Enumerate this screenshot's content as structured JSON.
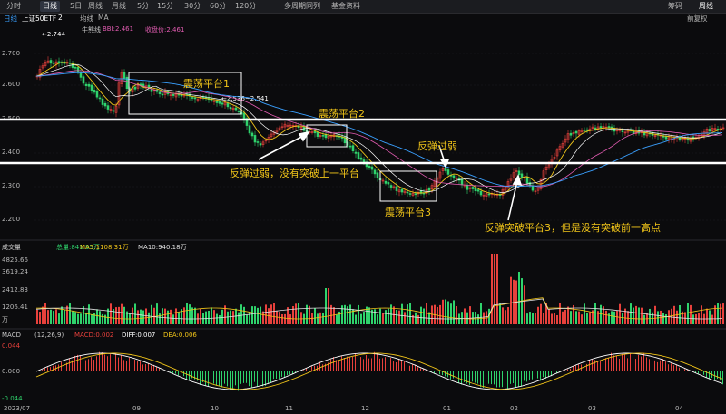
{
  "toolbar": {
    "tabs": [
      "分时",
      "日线",
      "5日",
      "周线",
      "月线",
      "5分",
      "15分",
      "30分",
      "60分",
      "120分",
      "多周期同列",
      "基金资料"
    ],
    "active_tab": "日线",
    "right_items": [
      "筹码",
      "周线"
    ]
  },
  "subbar": {
    "period": "日线",
    "symbol": "上证50ETF",
    "count": "2",
    "ma_label": "均线",
    "ma_prefix": "MA",
    "right": "前复权"
  },
  "price_panel": {
    "indicator_name": "牛熊线",
    "bbi": "BBI:2.461",
    "close": "收盘价:2.461",
    "high_marker": "←2.744",
    "mid_marker": "←2.536~2.541",
    "y_ticks": [
      "2.700",
      "2.600",
      "2.500",
      "2.400",
      "2.300",
      "2.200"
    ]
  },
  "annotations": {
    "platform1": "震荡平台1",
    "platform2": "震荡平台2",
    "platform3": "震荡平台3",
    "rebound_weak_1": "反弹过弱，没有突破上一平台",
    "rebound_weak_2": "反弹过弱",
    "rebound_break_3": "反弹突破平台3，但是没有突破前一高点"
  },
  "volume_panel": {
    "title": "成交量",
    "total": "总量:841.95万",
    "ma5": "MA5:1108.31万",
    "ma10": "MA10:940.18万",
    "y_ticks": [
      "4825.66",
      "3619.24",
      "2412.83",
      "1206.41"
    ],
    "unit": "万"
  },
  "macd_panel": {
    "title": "MACD",
    "params": "(12,26,9)",
    "macd": "MACD:0.002",
    "diff": "DIFF:0.007",
    "dea": "DEA:0.006",
    "y_ticks": [
      "0.044",
      "0.000",
      "-0.044"
    ]
  },
  "x_axis": [
    "2023/07",
    "09",
    "10",
    "11",
    "12",
    "01",
    "02",
    "03",
    "04"
  ],
  "colors": {
    "up": "#e8413c",
    "down": "#2fd36c",
    "ma_yellow": "#f0c419",
    "ma_pink": "#e05bb0",
    "ma_blue": "#3aa0ff",
    "annotation": "#f0c419"
  }
}
